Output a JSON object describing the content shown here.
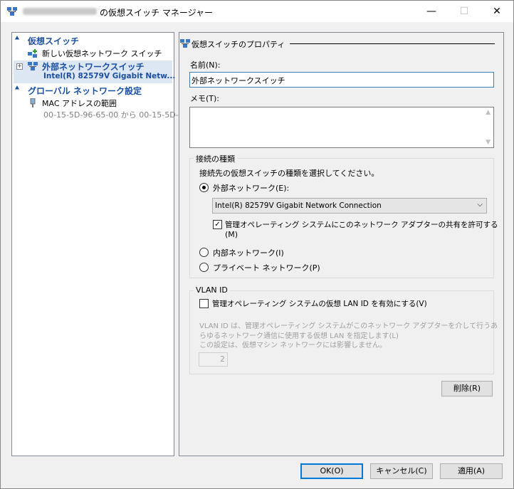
{
  "window": {
    "title": "の仮想スイッチ マネージャー",
    "minimize": "—",
    "maximize": "☐",
    "close": "✕"
  },
  "nav": {
    "virtual_switches_header": "仮想スイッチ",
    "new_switch": "新しい仮想ネットワーク スイッチ",
    "external_switch_name": "外部ネットワークスイッチ",
    "external_switch_adapter": "Intel(R) 82579V Gigabit Netw...",
    "global_settings_header": "グローバル ネットワーク設定",
    "mac_range_label": "MAC アドレスの範囲",
    "mac_range_value": "00-15-5D-96-65-00 から 00-15-5D-..."
  },
  "props": {
    "section_title": "仮想スイッチのプロパティ",
    "name_label": "名前(N):",
    "name_value": "外部ネットワークスイッチ",
    "memo_label": "メモ(T):",
    "memo_value": "",
    "connection_type_title": "接続の種類",
    "connection_type_desc": "接続先の仮想スイッチの種類を選択してください。",
    "external_network": "外部ネットワーク(E):",
    "adapter_selected": "Intel(R) 82579V Gigabit Network Connection",
    "allow_mgmt_share": "管理オペレーティング システムにこのネットワーク アダプターの共有を許可する",
    "allow_mgmt_share_key": "(M)",
    "internal_network": "内部ネットワーク(I)",
    "private_network": "プライベート ネットワーク(P)",
    "vlan_title": "VLAN ID",
    "vlan_enable": "管理オペレーティング システムの仮想 LAN ID を有効にする(V)",
    "vlan_desc_1": "VLAN ID は、管理オペレーティング システムがこのネットワーク アダプターを介して行うあ",
    "vlan_desc_2": "らゆるネットワーク通信に使用する仮想 LAN を指定します(L)",
    "vlan_desc_3": "この設定は、仮想マシン ネットワークには影響しません。",
    "vlan_value": "2",
    "remove_button": "削除(R)"
  },
  "footer": {
    "ok": "OK(O)",
    "cancel": "キャンセル(C)",
    "apply": "適用(A)"
  },
  "colors": {
    "accent": "#0078d7",
    "nav_header": "#1a4fa0",
    "selection": "#dde6f3"
  },
  "state": {
    "external_selected": true,
    "allow_mgmt_checked": true,
    "vlan_checked": false
  }
}
